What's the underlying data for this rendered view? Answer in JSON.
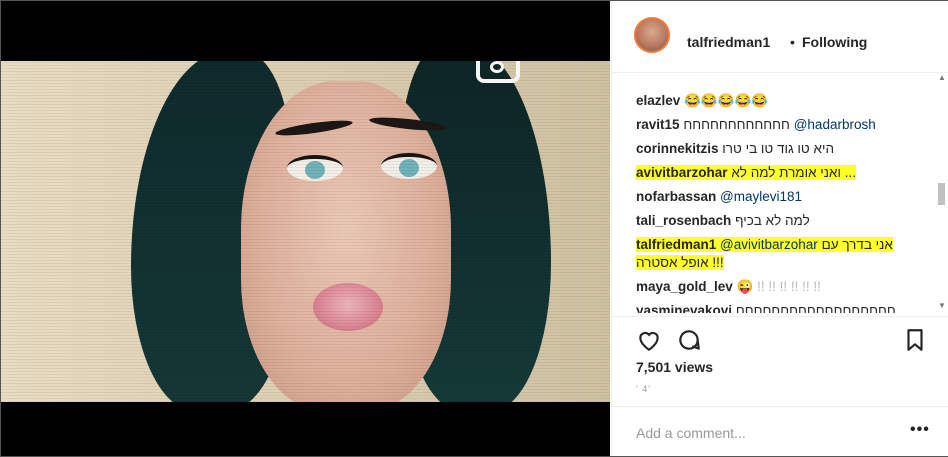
{
  "post": {
    "username": "talfriedman1",
    "dot": "•",
    "follow_status": "Following"
  },
  "comments": [
    {
      "user": "elazlev",
      "text": "😂😂😂😂😂",
      "mention": "",
      "highlight": false
    },
    {
      "user": "ravit15",
      "text": "חחחחחחחחחחחח",
      "mention": "@hadarbrosh",
      "highlight": false
    },
    {
      "user": "corinnekitzis",
      "text": "היא טו גוד טו בי טרו",
      "mention": "",
      "highlight": false
    },
    {
      "user": "avivitbarzohar",
      "text": "ואני אומרת למה לא ...",
      "mention": "",
      "highlight": true
    },
    {
      "user": "nofarbassan",
      "text": "",
      "mention": "@maylevi181",
      "highlight": false
    },
    {
      "user": "tali_rosenbach",
      "text": "למה לא בכיף",
      "mention": "",
      "highlight": false
    },
    {
      "user": "talfriedman1",
      "text": "אני בדרך עם",
      "mention": "@avivitbarzohar",
      "text2": "אופל אסטרה !!!",
      "highlight": true
    },
    {
      "user": "maya_gold_lev",
      "text": "😜 !! !! !! !! !! !!",
      "mention": "",
      "highlight": false
    },
    {
      "user": "yasminevakovi",
      "text": "חחחחחחחחחחחחחחחחחח",
      "mention": "",
      "highlight": false
    }
  ],
  "stats": {
    "views": "7,501 views",
    "date_partial": "' 4' "
  },
  "add_comment": {
    "placeholder": "Add a comment...",
    "more": "•••"
  },
  "colors": {
    "highlight": "#ffff2a",
    "mention": "#003569",
    "text": "#262626"
  },
  "icons": [
    "camera-icon",
    "heart-icon",
    "comment-icon",
    "bookmark-icon",
    "more-icon"
  ]
}
